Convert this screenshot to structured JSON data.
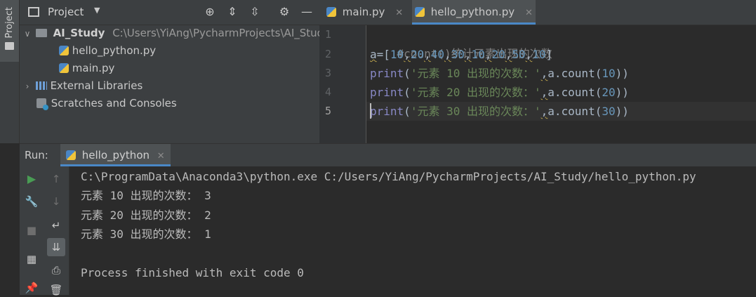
{
  "stripe": {
    "project_label": "Project"
  },
  "project_panel": {
    "title": "Project",
    "tree": {
      "root_name": "AI_Study",
      "root_path": "C:\\Users\\YiAng\\PycharmProjects\\AI_Study",
      "files": [
        "hello_python.py",
        "main.py"
      ],
      "external_libraries": "External Libraries",
      "scratches": "Scratches and Consoles"
    }
  },
  "editor": {
    "tabs": [
      {
        "label": "main.py"
      },
      {
        "label": "hello_python.py"
      }
    ],
    "line_numbers": [
      "1",
      "2",
      "3",
      "4",
      "5"
    ],
    "lines": {
      "l1_comment": "#count()统计元素出现的次数",
      "l3_str": "'元素 10 出现的次数：'",
      "l3_arg": "10",
      "l4_str": "'元素 20 出现的次数：'",
      "l4_arg": "20",
      "l5_str": "'元素 30 出现的次数：'",
      "l5_arg": "30"
    },
    "list_values": [
      "10",
      "20",
      "40",
      "30",
      "10",
      "20",
      "50",
      "10"
    ]
  },
  "run": {
    "label": "Run:",
    "tab": "hello_python"
  },
  "console": {
    "command": "C:\\ProgramData\\Anaconda3\\python.exe C:/Users/YiAng/PycharmProjects/AI_Study/hello_python.py",
    "outputs": [
      "元素 10 出现的次数： 3",
      "元素 20 出现的次数： 2",
      "元素 30 出现的次数： 1"
    ],
    "finish": "Process finished with exit code 0"
  },
  "colors": {
    "background": "#2b2b2b",
    "panel": "#3c3f41",
    "keyword": "#8888c6",
    "string": "#6a8759",
    "number": "#6897bb",
    "comment": "#808080",
    "run_green": "#499c54"
  }
}
